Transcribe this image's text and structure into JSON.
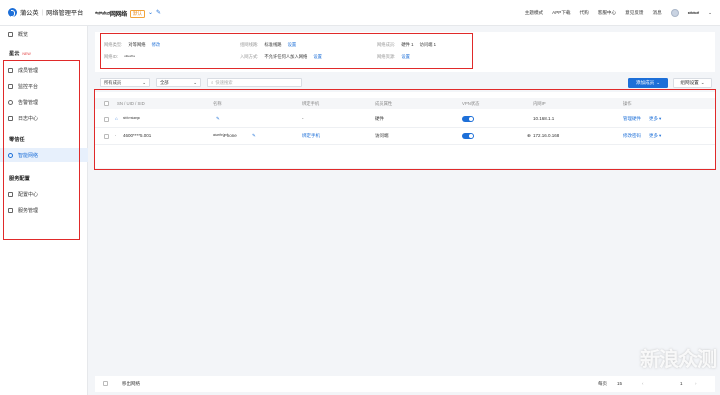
{
  "header": {
    "brand": "蒲公英",
    "product": "网络管理平台",
    "network_name": "*ᵛᵗ*ᵃᶠᵘᶻᵗ网网络",
    "default_badge": "默认",
    "links": [
      "主题模式",
      "APP下载",
      "代购",
      "客服中心",
      "意见反馈",
      "消息"
    ],
    "user": "ˢᵗᶠᶜᵗᵗᵉᵗᶠ"
  },
  "sidebar": {
    "overview": "概览",
    "group_star": "星云",
    "new_tag": "NEW",
    "items_star": [
      "成员管理",
      "监控平台",
      "告警管理",
      "日志中心"
    ],
    "group_zero": "零信任",
    "smart_net": "智能网络",
    "group_service": "服务配置",
    "items_service": [
      "配置中心",
      "服务管理"
    ]
  },
  "info": {
    "net_type_label": "网络类型:",
    "net_type_value": "对等网络",
    "net_type_action": "修改",
    "net_id_label": "网络ID:",
    "net_id_value": "ᵘᵗᵇᵉˣᶠᵗᵃ",
    "line_label": "组网线路:",
    "line_value": "标准线路",
    "line_action": "设置",
    "join_label": "入网方式:",
    "join_value": "不允许任何人加入网络",
    "join_action": "设置",
    "cap_label": "网络成员:",
    "cap_value_1": "硬件 1",
    "cap_value_2": "访问端 1",
    "res_label": "网络资源:",
    "res_action": "设置"
  },
  "filters": {
    "members_select": "所有成员",
    "status_select": "全部",
    "search_placeholder": "快速搜索",
    "add_member": "添加成员",
    "group_settings": "组网设置"
  },
  "table": {
    "headers": [
      "SN / UID / SID",
      "名称",
      "绑定手机",
      "成员属性",
      "VPN状态",
      "内网IP",
      "操作"
    ],
    "rows": [
      {
        "id": "ˢᵗᵗᶠᶜ*ˢᵗᵃᵉᵍᶜ",
        "name": "",
        "phone": "-",
        "attr": "硬件",
        "ip": "10.168.1.1",
        "op1": "管理硬件",
        "more": "更多"
      },
      {
        "id": "4600****5.001",
        "name": "ᵃᵗᵘᵉᵗᶠᵉiPhone",
        "phone": "绑定手机",
        "attr": "访问端",
        "ip": "172.16.0.168",
        "op1": "修改密码",
        "more": "更多"
      }
    ]
  },
  "footer": {
    "remove": "移出网络",
    "per_page_label": "每页",
    "per_page": "15",
    "page": "1"
  },
  "watermark": "新浪众测"
}
